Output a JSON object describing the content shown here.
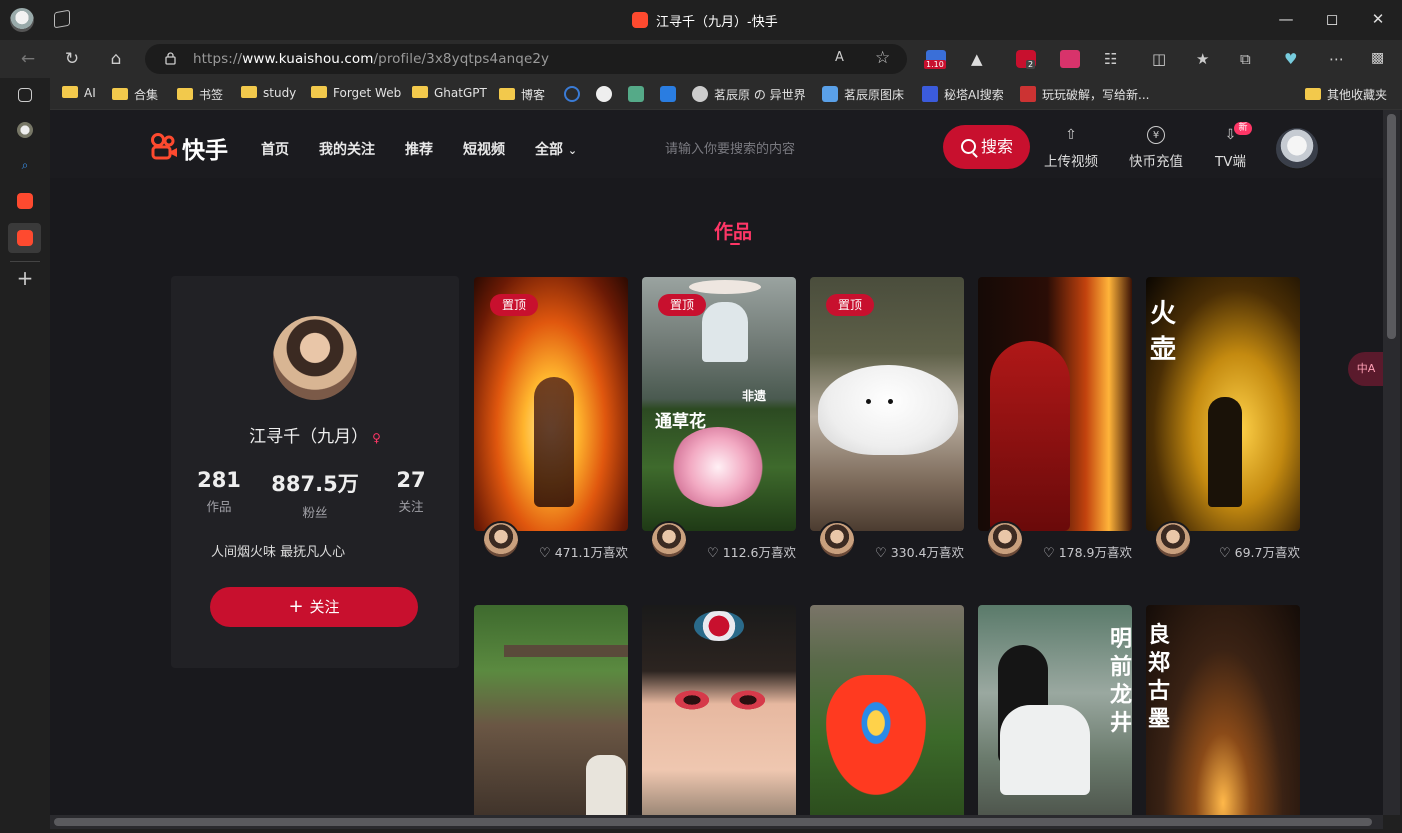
{
  "window": {
    "title": "江寻千（九月）-快手",
    "controls": [
      "minimize",
      "maximize",
      "close"
    ]
  },
  "browser": {
    "url_prefix": "https://",
    "url_domain": "www.kuaishou.com",
    "url_path": "/profile/3x8yqtps4anqe2y",
    "ext_badge_1": "1.10",
    "ext_badge_2": "2",
    "read_aloud": "A",
    "bookmarks": [
      {
        "label": "AI",
        "type": "folder"
      },
      {
        "label": "合集",
        "type": "folder"
      },
      {
        "label": "书签",
        "type": "folder"
      },
      {
        "label": "study",
        "type": "folder"
      },
      {
        "label": "Forget Web",
        "type": "folder"
      },
      {
        "label": "GhatGPT",
        "type": "folder"
      },
      {
        "label": "博客",
        "type": "folder"
      },
      {
        "label": "茗辰原 の 异世界",
        "type": "site"
      },
      {
        "label": "茗辰原图床",
        "type": "site"
      },
      {
        "label": "秘塔AI搜索",
        "type": "site"
      },
      {
        "label": "玩玩破解，写给新...",
        "type": "site"
      },
      {
        "label": "其他收藏夹",
        "type": "folder"
      }
    ]
  },
  "header": {
    "logo_text": "快手",
    "nav": [
      "首页",
      "我的关注",
      "推荐",
      "短视频",
      "全部"
    ],
    "search_placeholder": "请输入你要搜索的内容",
    "search_button": "搜索",
    "actions": [
      {
        "label": "上传视频",
        "icon": "upload-icon"
      },
      {
        "label": "快币充值",
        "icon": "coin-icon"
      },
      {
        "label": "TV端",
        "icon": "download-icon"
      }
    ],
    "tv_badge": "新"
  },
  "section_title": "作品",
  "profile": {
    "name": "江寻千（九月）",
    "gender_symbol": "♀",
    "stats": [
      {
        "value": "281",
        "label": "作品"
      },
      {
        "value": "887.5万",
        "label": "粉丝"
      },
      {
        "value": "27",
        "label": "关注"
      }
    ],
    "bio": "人间烟火味 最抚凡人心",
    "follow_button": "关注"
  },
  "videos": [
    {
      "pinned": true,
      "pin_label": "置顶",
      "likes": "471.1万喜欢"
    },
    {
      "pinned": true,
      "pin_label": "置顶",
      "likes": "112.6万喜欢",
      "overlay_text": [
        "非遗",
        "通草花"
      ]
    },
    {
      "pinned": true,
      "pin_label": "置顶",
      "likes": "330.4万喜欢"
    },
    {
      "pinned": false,
      "likes": "178.9万喜欢"
    },
    {
      "pinned": false,
      "likes": "69.7万喜欢",
      "overlay_text": [
        "火",
        "壶"
      ]
    },
    {
      "pinned": false
    },
    {
      "pinned": false
    },
    {
      "pinned": false
    },
    {
      "pinned": false,
      "overlay_text": [
        "明",
        "前",
        "龙",
        "井"
      ]
    },
    {
      "pinned": false,
      "overlay_text": [
        "良",
        "郑",
        "古",
        "墨"
      ]
    }
  ],
  "translate_chip": "中A",
  "colors": {
    "accent": "#c8102e",
    "accent_pink": "#fe3666",
    "page_bg": "#19191d"
  }
}
